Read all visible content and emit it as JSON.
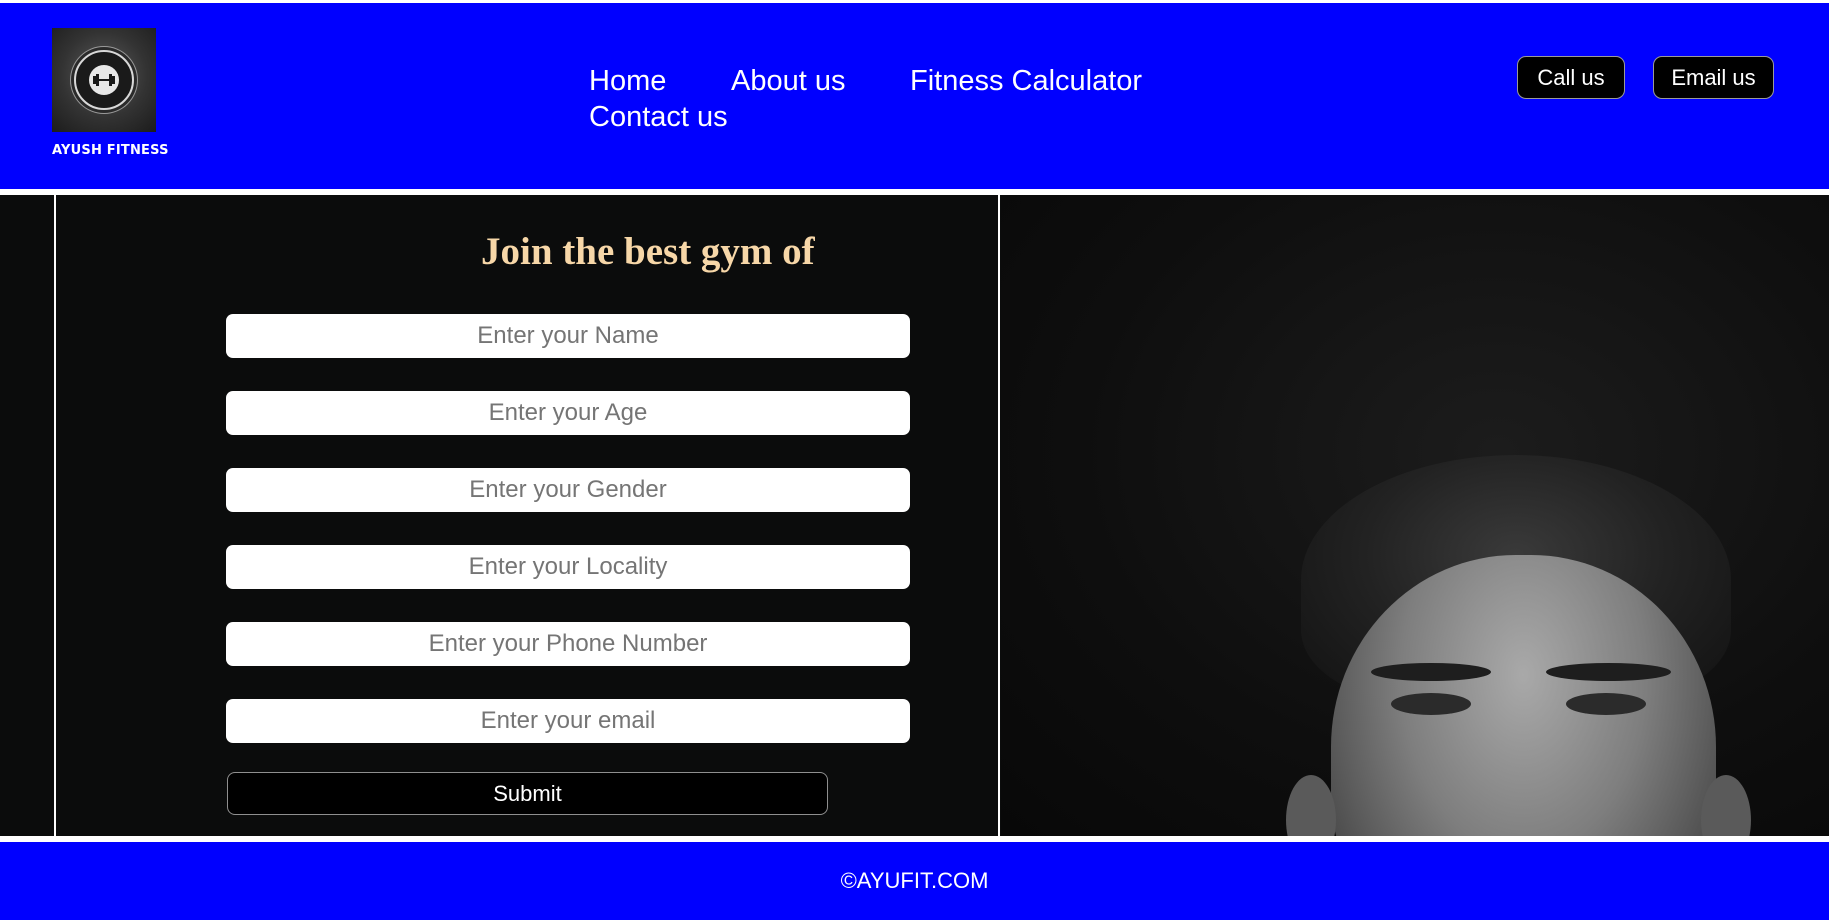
{
  "brand": {
    "name": "AYUSH FITNESS",
    "logo_icon": "dumbbell-icon"
  },
  "nav": {
    "items": [
      {
        "label": "Home"
      },
      {
        "label": "About us"
      },
      {
        "label": "Fitness Calculator"
      },
      {
        "label": "Contact us"
      }
    ]
  },
  "header_buttons": {
    "call": "Call us",
    "email": "Email us"
  },
  "form": {
    "title": "Join the best gym of",
    "fields": [
      {
        "placeholder": "Enter your Name"
      },
      {
        "placeholder": "Enter your Age"
      },
      {
        "placeholder": "Enter your Gender"
      },
      {
        "placeholder": "Enter your Locality"
      },
      {
        "placeholder": "Enter your Phone Number"
      },
      {
        "placeholder": "Enter your email"
      }
    ],
    "submit_label": "Submit"
  },
  "footer": {
    "text": "©AYUFIT.COM"
  },
  "colors": {
    "header_bg": "#0000ff",
    "footer_bg": "#0000ff",
    "panel_bg": "#0b0c0c",
    "title_color": "#f7d7a8",
    "button_bg": "#000000"
  }
}
